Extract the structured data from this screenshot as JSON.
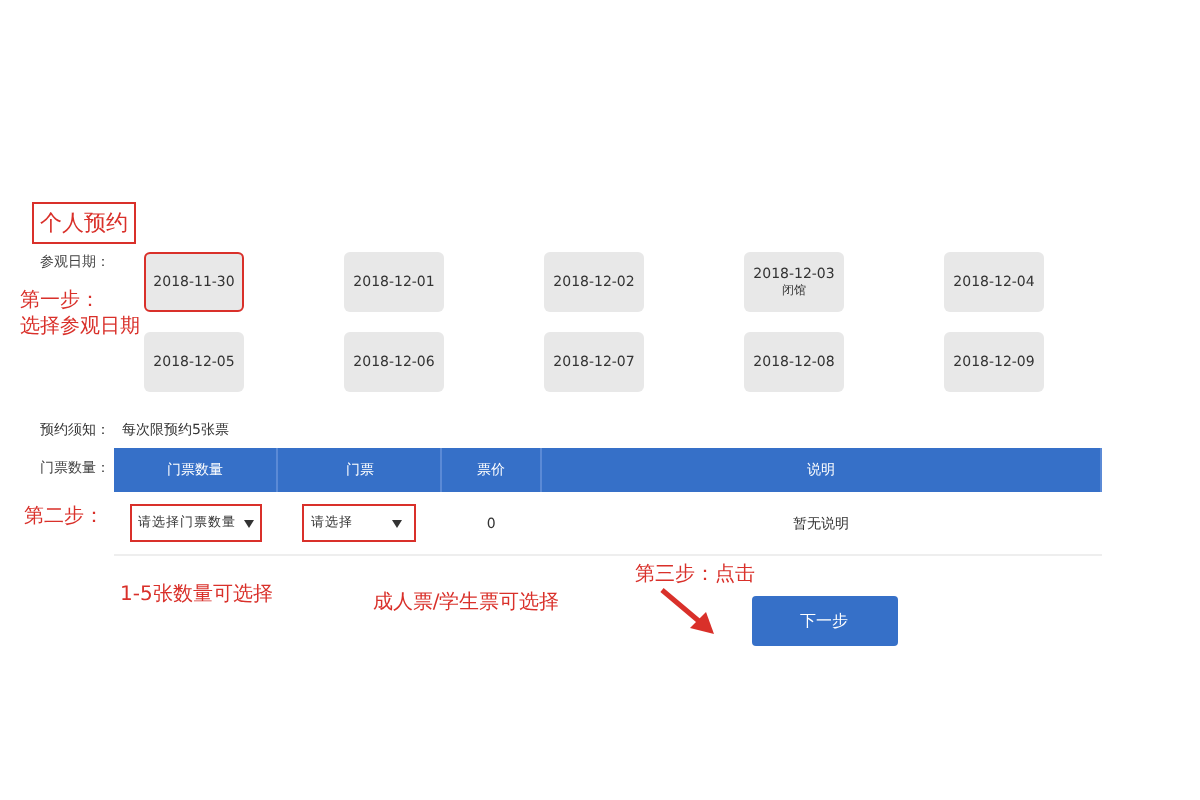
{
  "title": "个人预约",
  "date_label": "参观日期：",
  "step1": {
    "line1": "第一步：",
    "line2": "选择参观日期"
  },
  "dates": [
    {
      "date": "2018-11-30",
      "annotated": true
    },
    {
      "date": "2018-12-01",
      "annotated": false
    },
    {
      "date": "2018-12-02",
      "annotated": false
    },
    {
      "date": "2018-12-03",
      "note": "闭馆",
      "annotated": false
    },
    {
      "date": "2018-12-04",
      "annotated": false
    },
    {
      "date": "2018-12-05",
      "annotated": false
    },
    {
      "date": "2018-12-06",
      "annotated": false
    },
    {
      "date": "2018-12-07",
      "annotated": false
    },
    {
      "date": "2018-12-08",
      "annotated": false
    },
    {
      "date": "2018-12-09",
      "annotated": false
    }
  ],
  "notice": {
    "label": "预约须知：",
    "text": "每次限预约5张票"
  },
  "quantity_label": "门票数量：",
  "step2": "第二步：",
  "table": {
    "columns": [
      "门票数量",
      "门票",
      "票价",
      "说明"
    ],
    "row": {
      "quantity_select": "请选择门票数量",
      "ticket_select": "请选择",
      "price": "0",
      "description": "暂无说明"
    }
  },
  "notes": {
    "quantity": "1-5张数量可选择",
    "ticket": "成人票/学生票可选择"
  },
  "step3": "第三步：点击",
  "next_button": "下一步"
}
